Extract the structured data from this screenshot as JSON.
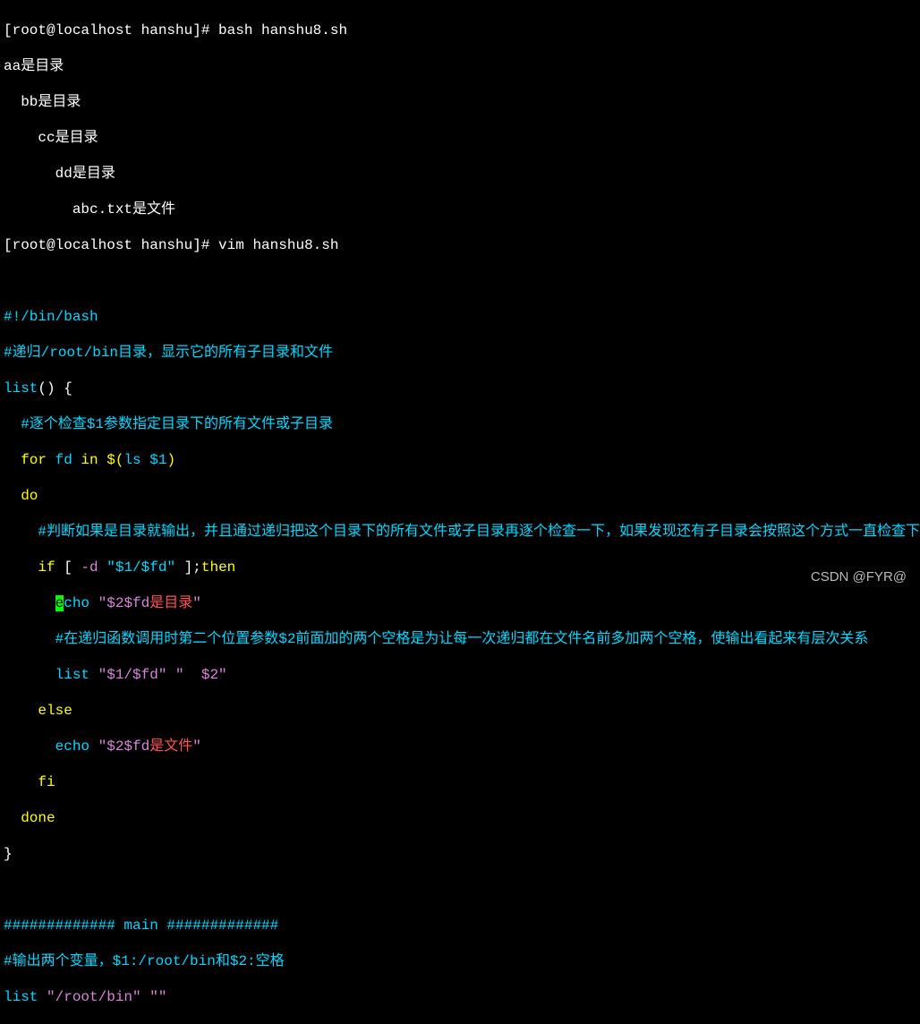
{
  "prompt1": {
    "user_host": "[root@localhost hanshu]# ",
    "command": "bash hanshu8.sh"
  },
  "output": {
    "line1": "aa是目录",
    "line2": "  bb是目录",
    "line3": "    cc是目录",
    "line4": "      dd是目录",
    "line5": "        abc.txt是文件"
  },
  "prompt2": {
    "user_host": "[root@localhost hanshu]# ",
    "command": "vim hanshu8.sh"
  },
  "script": {
    "shebang": "#!/bin/bash",
    "comment1_prefix": "#递归",
    "comment1_path": "/root/bin",
    "comment1_suffix": "目录，显示它的所有子目录和文件",
    "list_func": "list",
    "paren_open": "() {",
    "comment2": "  #逐个检查$1参数指定目录下的所有文件或子目录",
    "for_kw": "  for",
    "for_var": " fd ",
    "in_kw": "in",
    "for_dollar": " $(",
    "ls_cmd": "ls ",
    "ls_arg": "$1",
    "for_close": ")",
    "do_kw": "  do",
    "comment3": "    #判断如果是目录就输出，并且通过递归把这个目录下的所有文件或子目录再逐个检查一下，如果发现还有子目录会按照这个方式一直检查下去",
    "if_kw": "    if",
    "if_bracket1": " [ ",
    "if_flag": "-d",
    "if_space": " ",
    "if_str": "\"$1/$fd\"",
    "if_bracket2": " ];",
    "then_kw": "then",
    "echo_cursor": "      ",
    "echo_e": "e",
    "echo_cho": "cho",
    "echo_space": " ",
    "echo_str1": "\"$2$fd",
    "echo_cn1": "是目录",
    "echo_q1": "\"",
    "comment4": "      #在递归函数调用时第二个位置参数$2前面加的两个空格是为让每一次递归都在文件名前多加两个空格，使输出看起来有层次关系",
    "list_call": "      list ",
    "list_arg1": "\"$1/$fd\"",
    "list_sp": " ",
    "list_arg2": "\"  $2\"",
    "else_kw": "    else",
    "echo2_indent": "      ",
    "echo2": "echo",
    "echo2_sp": " ",
    "echo2_str": "\"$2$fd",
    "echo2_cn": "是文件",
    "echo2_q": "\"",
    "fi_kw": "    fi",
    "done_kw": "  done",
    "brace_close": "}",
    "main_sep": "############# main #############",
    "comment5_prefix": "#输出两个变量，",
    "comment5_var1": "$1",
    "comment5_mid": ":/root/bin和",
    "comment5_var2": "$2",
    "comment5_suffix": ":空格",
    "final_list": "list ",
    "final_arg1": "\"/root/bin\"",
    "final_sp": " ",
    "final_arg2": "\"\""
  },
  "watermark": "CSDN @FYR@"
}
